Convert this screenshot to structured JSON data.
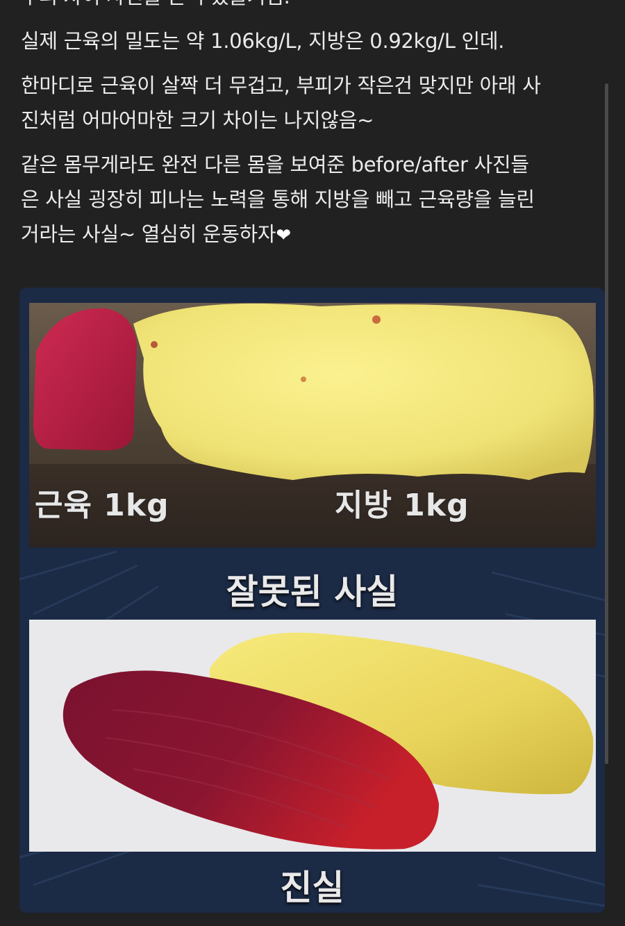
{
  "post": {
    "cut_line": "부피 차이 사진을 본적 있을거임.",
    "paragraph1": "실제 근육의 밀도는 약 1.06kg/L, 지방은 0.92kg/L 인데.",
    "paragraph2_line1": "한마디로 근육이 살짝 더 무겁고, 부피가 작은건 맞지만 아래 사",
    "paragraph2_line2": "진처럼 어마어마한 크기 차이는 나지않음~",
    "paragraph3_line1": "같은 몸무게라도 완전 다른 몸을 보여준 before/after 사진들",
    "paragraph3_line2": "은 사실 굉장히 피나는 노력을 통해 지방을 빼고 근육량을 늘린",
    "paragraph3_line3": "거라는 사실~ 열심히 운동하자",
    "heart": "❤"
  },
  "figure": {
    "top_label_left": "근육 1kg",
    "top_label_right": "지방 1kg",
    "top_caption": "잘못된 사실",
    "bottom_caption": "진실"
  },
  "colors": {
    "background": "#212121",
    "text": "#ececec",
    "figure_bg": "#1b2a45",
    "muscle": "#b01c3c",
    "fat": "#f0e07a"
  }
}
